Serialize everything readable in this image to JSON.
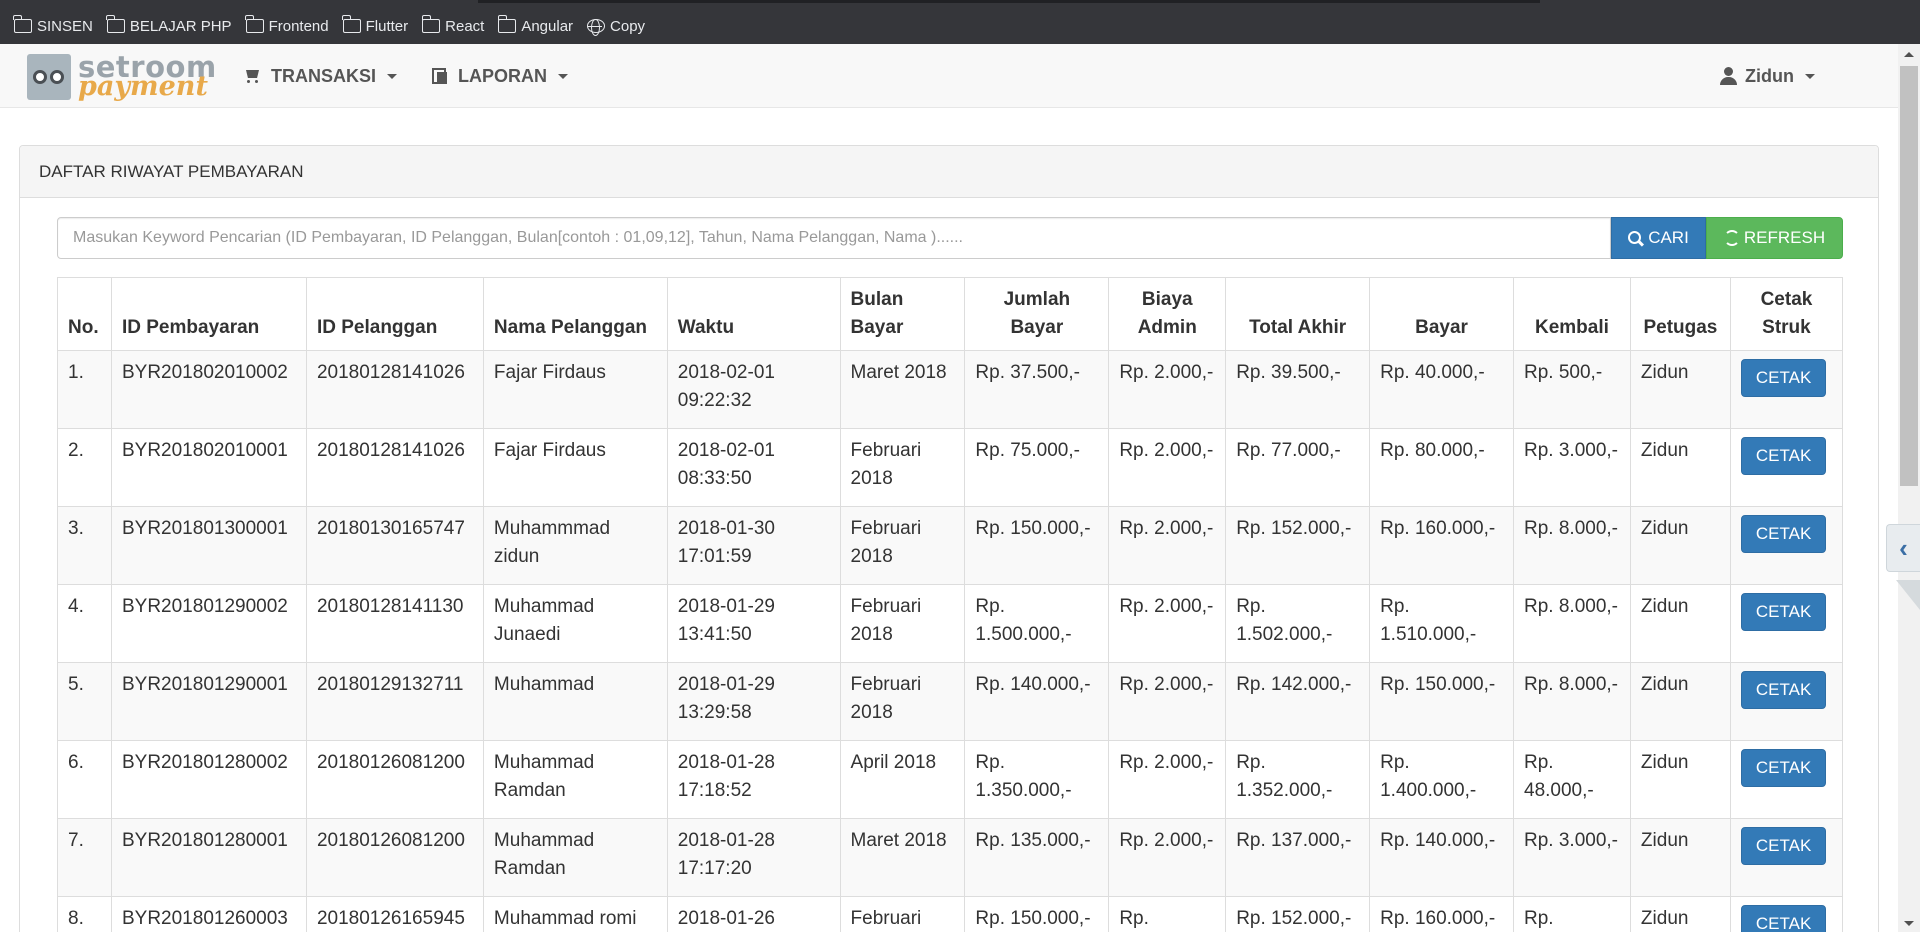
{
  "bookmarks": [
    {
      "label": "SINSEN",
      "icon": "folder-icon"
    },
    {
      "label": "BELAJAR PHP",
      "icon": "folder-icon"
    },
    {
      "label": "Frontend",
      "icon": "folder-icon"
    },
    {
      "label": "Flutter",
      "icon": "folder-icon"
    },
    {
      "label": "React",
      "icon": "folder-icon"
    },
    {
      "label": "Angular",
      "icon": "folder-icon"
    },
    {
      "label": "Copy",
      "icon": "globe-icon"
    }
  ],
  "navbar": {
    "brand_top": "setroom",
    "brand_bottom": "payment",
    "menu_transaksi": "TRANSAKSI",
    "menu_laporan": "LAPORAN",
    "user": "Zidun"
  },
  "panel": {
    "title": "DAFTAR RIWAYAT PEMBAYARAN",
    "search_placeholder": "Masukan Keyword Pencarian (ID Pembayaran, ID Pelanggan, Bulan[contoh : 01,09,12], Tahun, Nama Pelanggan, Nama )......",
    "search_button": "CARI",
    "refresh_button": "REFRESH"
  },
  "table": {
    "headers": [
      "No.",
      "ID Pembayaran",
      "ID Pelanggan",
      "Nama Pelanggan",
      "Waktu",
      "Bulan Bayar",
      "Jumlah Bayar",
      "Biaya Admin",
      "Total Akhir",
      "Bayar",
      "Kembali",
      "Petugas",
      "Cetak Struk"
    ],
    "action_label": "CETAK",
    "rows": [
      {
        "no": "1.",
        "id_bayar": "BYR201802010002",
        "id_pel": "20180128141026",
        "nama": "Fajar Firdaus",
        "waktu": "2018-02-01 09:22:32",
        "bulan": "Maret 2018",
        "jumlah": "Rp. 37.500,-",
        "admin": "Rp. 2.000,-",
        "total": "Rp. 39.500,-",
        "bayar": "Rp. 40.000,-",
        "kembali": "Rp. 500,-",
        "petugas": "Zidun"
      },
      {
        "no": "2.",
        "id_bayar": "BYR201802010001",
        "id_pel": "20180128141026",
        "nama": "Fajar Firdaus",
        "waktu": "2018-02-01 08:33:50",
        "bulan": "Februari 2018",
        "jumlah": "Rp. 75.000,-",
        "admin": "Rp. 2.000,-",
        "total": "Rp. 77.000,-",
        "bayar": "Rp. 80.000,-",
        "kembali": "Rp. 3.000,-",
        "petugas": "Zidun"
      },
      {
        "no": "3.",
        "id_bayar": "BYR201801300001",
        "id_pel": "20180130165747",
        "nama": "Muhammmad zidun",
        "waktu": "2018-01-30 17:01:59",
        "bulan": "Februari 2018",
        "jumlah": "Rp. 150.000,-",
        "admin": "Rp. 2.000,-",
        "total": "Rp. 152.000,-",
        "bayar": "Rp. 160.000,-",
        "kembali": "Rp. 8.000,-",
        "petugas": "Zidun"
      },
      {
        "no": "4.",
        "id_bayar": "BYR201801290002",
        "id_pel": "20180128141130",
        "nama": "Muhammad Junaedi",
        "waktu": "2018-01-29 13:41:50",
        "bulan": "Februari 2018",
        "jumlah": "Rp. 1.500.000,-",
        "admin": "Rp. 2.000,-",
        "total": "Rp. 1.502.000,-",
        "bayar": "Rp. 1.510.000,-",
        "kembali": "Rp. 8.000,-",
        "petugas": "Zidun"
      },
      {
        "no": "5.",
        "id_bayar": "BYR201801290001",
        "id_pel": "20180129132711",
        "nama": "Muhammad",
        "waktu": "2018-01-29 13:29:58",
        "bulan": "Februari 2018",
        "jumlah": "Rp. 140.000,-",
        "admin": "Rp. 2.000,-",
        "total": "Rp. 142.000,-",
        "bayar": "Rp. 150.000,-",
        "kembali": "Rp. 8.000,-",
        "petugas": "Zidun"
      },
      {
        "no": "6.",
        "id_bayar": "BYR201801280002",
        "id_pel": "20180126081200",
        "nama": "Muhammad Ramdan",
        "waktu": "2018-01-28 17:18:52",
        "bulan": "April 2018",
        "jumlah": "Rp. 1.350.000,-",
        "admin": "Rp. 2.000,-",
        "total": "Rp. 1.352.000,-",
        "bayar": "Rp. 1.400.000,-",
        "kembali": "Rp. 48.000,-",
        "petugas": "Zidun"
      },
      {
        "no": "7.",
        "id_bayar": "BYR201801280001",
        "id_pel": "20180126081200",
        "nama": "Muhammad Ramdan",
        "waktu": "2018-01-28 17:17:20",
        "bulan": "Maret 2018",
        "jumlah": "Rp. 135.000,-",
        "admin": "Rp. 2.000,-",
        "total": "Rp. 137.000,-",
        "bayar": "Rp. 140.000,-",
        "kembali": "Rp. 3.000,-",
        "petugas": "Zidun"
      },
      {
        "no": "8.",
        "id_bayar": "BYR201801260003",
        "id_pel": "20180126165945",
        "nama": "Muhammad romi",
        "waktu": "2018-01-26",
        "bulan": "Februari",
        "jumlah": "Rp. 150.000,-",
        "admin": "Rp.",
        "total": "Rp. 152.000,-",
        "bayar": "Rp. 160.000,-",
        "kembali": "Rp.",
        "petugas": "Zidun"
      }
    ]
  },
  "colors": {
    "primary": "#337ab7",
    "success": "#5cb85c",
    "bookmarks_bg": "#35363a",
    "navbar_bg": "#f8f8f8"
  }
}
